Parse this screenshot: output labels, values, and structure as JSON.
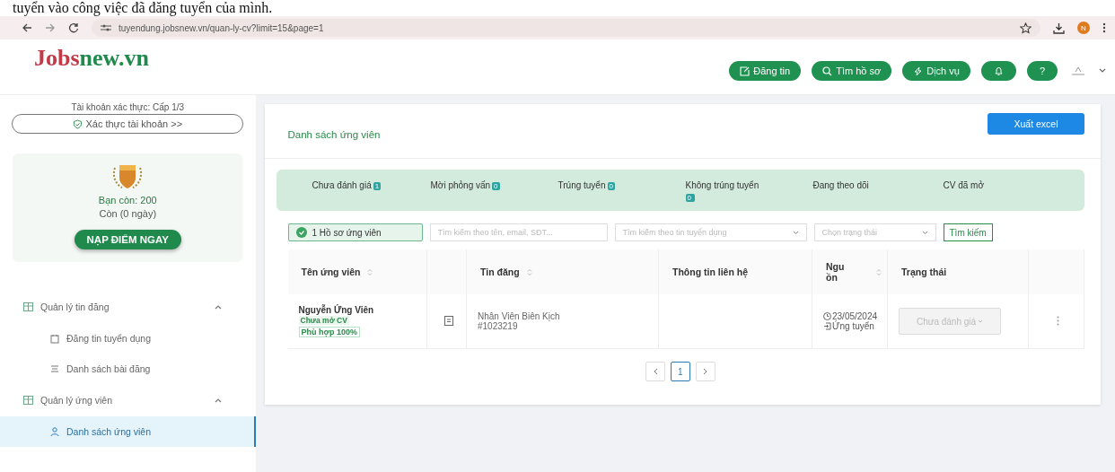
{
  "document_text": "tuyển vào công việc đã đăng tuyển của mình.",
  "browser": {
    "url": "tuyendung.jobsnew.vn/quan-ly-cv?limit=15&page=1",
    "profile_initial": "N"
  },
  "header": {
    "logo": {
      "first": "Jobs",
      "second": "new.vn"
    },
    "buttons": [
      {
        "kind": "post",
        "label": "Đăng tin"
      },
      {
        "kind": "search",
        "label": "Tìm hồ sơ"
      },
      {
        "kind": "service",
        "label": "Dịch vụ"
      },
      {
        "kind": "bell"
      },
      {
        "kind": "help",
        "label": "?"
      }
    ]
  },
  "sidebar": {
    "verify_level": "Tài khoản xác thực: Cấp 1/3",
    "verify_button": "Xác thực tài khoản >>",
    "balance": "Bạn còn: 200",
    "days_left": "Còn (0 ngày)",
    "topup_button": "NẠP ĐIỂM NGAY",
    "menu": [
      {
        "label": "Quản lý tin đăng",
        "expanded": true,
        "children": [
          {
            "kind": "post",
            "label": "Đăng tin tuyển dụng",
            "selected": false
          },
          {
            "kind": "list",
            "label": "Danh sách bài đăng",
            "selected": false
          }
        ]
      },
      {
        "label": "Quản lý ứng viên",
        "expanded": true,
        "children": [
          {
            "kind": "person",
            "label": "Danh sách ứng viên",
            "selected": true
          }
        ]
      }
    ]
  },
  "main": {
    "title": "Danh sách ứng viên",
    "export_button": "Xuất excel",
    "status_tabs": [
      {
        "label": "Chưa đánh giá",
        "count": "1"
      },
      {
        "label": "Mời phỏng vấn",
        "count": "0"
      },
      {
        "label": "Trúng tuyển",
        "count": "0"
      },
      {
        "label": "Không trúng tuyển",
        "count": "0"
      },
      {
        "label": "Đang theo dõi"
      },
      {
        "label": "CV đã mở"
      }
    ],
    "filters": {
      "result_chip": "1 Hồ sơ ứng viên",
      "search": {
        "placeholder": "Tìm kiếm theo tên, email, SĐT..."
      },
      "job_select": {
        "placeholder": "Tìm kiếm theo tin tuyển dụng"
      },
      "status_select": {
        "placeholder": "Chọn trạng thái"
      },
      "search_button": "Tìm kiếm"
    },
    "table": {
      "columns": [
        {
          "label": "Tên ứng viên",
          "sortable": true
        },
        {
          "sortable": false
        },
        {
          "label": "Tin đăng",
          "sortable": true
        },
        {
          "label": "Thông tin liên hệ",
          "sortable": false
        },
        {
          "label": "Nguồn",
          "sortable": true
        },
        {
          "label": "Trạng thái",
          "sortable": false
        },
        {
          "sortable": false
        }
      ],
      "rows": [
        {
          "name": "Nguyễn Ứng Viên",
          "cv_status": "Chưa mở CV",
          "match": "Phù hợp 100%",
          "job_title": "Nhân Viên Biên Kịch",
          "job_id": "#1023219",
          "date": "23/05/2024",
          "source": "Ứng tuyển",
          "status": "Chưa đánh giá"
        }
      ]
    },
    "pagination": {
      "pages": [
        {
          "label": "1",
          "selected": true
        }
      ]
    }
  }
}
